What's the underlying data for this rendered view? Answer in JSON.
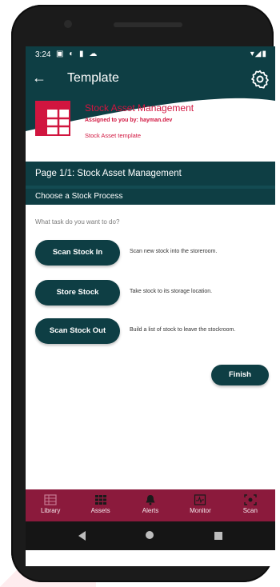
{
  "status_bar": {
    "time": "3:24"
  },
  "app_bar": {
    "title": "Template"
  },
  "header": {
    "title": "Stock Asset Management",
    "assigned": "Assigned to you by: hayman.dev",
    "template": "Stock Asset template"
  },
  "page": {
    "title": "Page 1/1: Stock Asset Management"
  },
  "section": {
    "title": "Choose a Stock Process"
  },
  "question": "What task do you want to do?",
  "options": [
    {
      "label": "Scan Stock In",
      "description": "Scan new stock into the storeroom."
    },
    {
      "label": "Store Stock",
      "description": "Take stock to its storage location."
    },
    {
      "label": "Scan Stock Out",
      "description": "Build a list of stock to leave the stockroom."
    }
  ],
  "finish_label": "Finish",
  "bottom_nav": [
    {
      "label": "Library",
      "icon": "library-icon"
    },
    {
      "label": "Assets",
      "icon": "assets-icon"
    },
    {
      "label": "Alerts",
      "icon": "bell-icon"
    },
    {
      "label": "Monitor",
      "icon": "monitor-icon"
    },
    {
      "label": "Scan",
      "icon": "scan-icon"
    }
  ],
  "colors": {
    "primary": "#0e3e44",
    "accent": "#d1153f",
    "nav": "#8b1a3c"
  }
}
